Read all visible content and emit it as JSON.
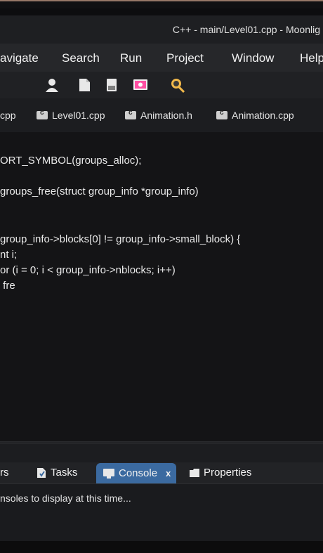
{
  "window": {
    "title": "C++  -  main/Level01.cpp  -  Moonlig"
  },
  "menu": {
    "items": [
      "avigate",
      "Search",
      "Run",
      "Project",
      "Window",
      "Help"
    ]
  },
  "toolbar": {
    "icons": [
      "person-icon",
      "file-icon",
      "save-icon",
      "monitor-icon",
      "debug-icon"
    ]
  },
  "tabs": {
    "items": [
      "cpp",
      "Level01.cpp",
      "Animation.h",
      "Animation.cpp"
    ]
  },
  "code": {
    "lines": [
      "ORT_SYMBOL(groups_alloc);",
      "groups_free(struct group_info *group_info)",
      "group_info->blocks[0] != group_info->small_block) {",
      "nt i;",
      "or (i = 0; i < group_info->nblocks; i++)",
      " fre"
    ]
  },
  "bottom_tabs": {
    "items": [
      "rs",
      "Tasks",
      "Console",
      "Properties"
    ],
    "console_close": "x"
  },
  "console": {
    "message": "nsoles to display at this time..."
  },
  "colors": {
    "accent": "#3b6aa0",
    "editor_bg": "#141416"
  }
}
